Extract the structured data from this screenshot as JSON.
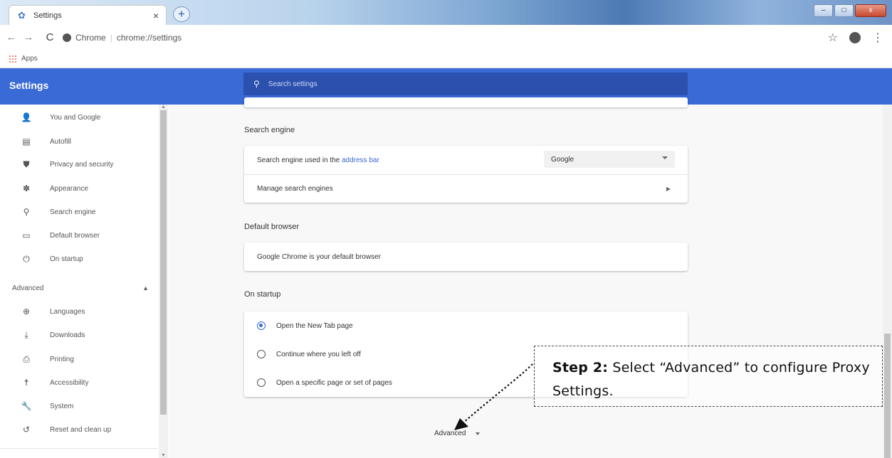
{
  "browser": {
    "tab_title": "Settings",
    "tab_close": "×",
    "new_tab": "+",
    "omnibox_site": "Chrome",
    "omnibox_url": "chrome://settings",
    "bookmark_apps": "Apps",
    "win_min": "–",
    "win_max": "□",
    "win_close": "x"
  },
  "header": {
    "title": "Settings",
    "search_placeholder": "Search settings"
  },
  "sidebar": {
    "items": [
      {
        "label": "You and Google",
        "icon": "person-icon"
      },
      {
        "label": "Autofill",
        "icon": "clipboard-icon"
      },
      {
        "label": "Privacy and security",
        "icon": "shield-icon"
      },
      {
        "label": "Appearance",
        "icon": "palette-icon"
      },
      {
        "label": "Search engine",
        "icon": "search-icon"
      },
      {
        "label": "Default browser",
        "icon": "browser-icon"
      },
      {
        "label": "On startup",
        "icon": "power-icon"
      }
    ],
    "advanced_label": "Advanced",
    "advanced_items": [
      {
        "label": "Languages",
        "icon": "globe-icon"
      },
      {
        "label": "Downloads",
        "icon": "download-icon"
      },
      {
        "label": "Printing",
        "icon": "printer-icon"
      },
      {
        "label": "Accessibility",
        "icon": "accessibility-icon"
      },
      {
        "label": "System",
        "icon": "wrench-icon"
      },
      {
        "label": "Reset and clean up",
        "icon": "reset-icon"
      }
    ]
  },
  "search_engine": {
    "title": "Search engine",
    "used_prefix": "Search engine used in the ",
    "used_link": "address bar",
    "selected": "Google",
    "manage": "Manage search engines"
  },
  "default_browser": {
    "title": "Default browser",
    "status": "Google Chrome is your default browser"
  },
  "on_startup": {
    "title": "On startup",
    "options": [
      "Open the New Tab page",
      "Continue where you left off",
      "Open a specific page or set of pages"
    ],
    "selected_index": 0
  },
  "advanced_button": "Advanced",
  "callout": {
    "step": "Step 2:",
    "text": " Select “Advanced” to configure Proxy Settings."
  }
}
